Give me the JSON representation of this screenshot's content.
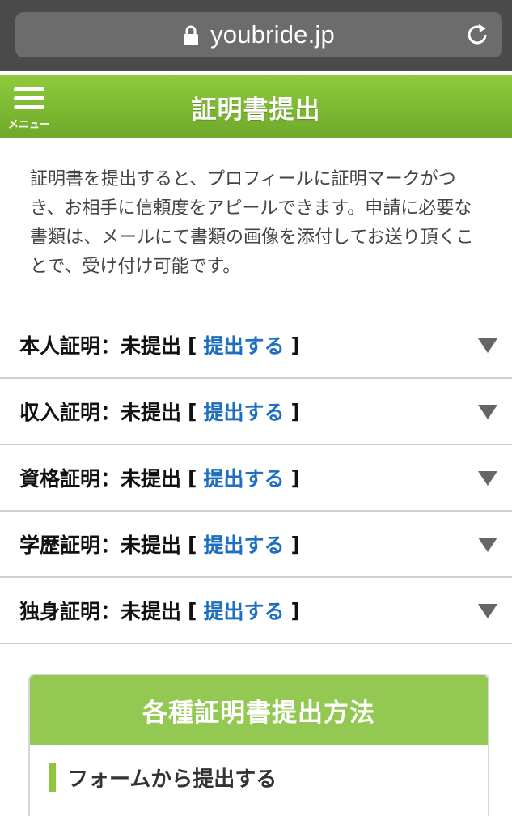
{
  "browser": {
    "url": "youbride.jp"
  },
  "header": {
    "menu_label": "メニュー",
    "title": "証明書提出"
  },
  "intro_text": "証明書を提出すると、プロフィールに証明マークがつき、お相手に信頼度をアピールできます。申請に必要な書類は、メールにて書類の画像を添付してお送り頂くことで、受け付け可能です。",
  "certificates": [
    {
      "name": "本人証明",
      "sep": "：",
      "status": "未提出",
      "link": "提出する"
    },
    {
      "name": "収入証明",
      "sep": "：",
      "status": "未提出",
      "link": "提出する"
    },
    {
      "name": "資格証明",
      "sep": "：",
      "status": "未提出",
      "link": "提出する"
    },
    {
      "name": "学歴証明",
      "sep": "：",
      "status": "未提出",
      "link": "提出する"
    },
    {
      "name": "独身証明",
      "sep": "：",
      "status": "未提出",
      "link": "提出する"
    }
  ],
  "brackets": {
    "open": "[",
    "close": "]"
  },
  "methods": {
    "title": "各種証明書提出方法",
    "subtitle": "フォームから提出する"
  },
  "colors": {
    "accent_green": "#8cc63f",
    "link_blue": "#1f6fc1"
  }
}
